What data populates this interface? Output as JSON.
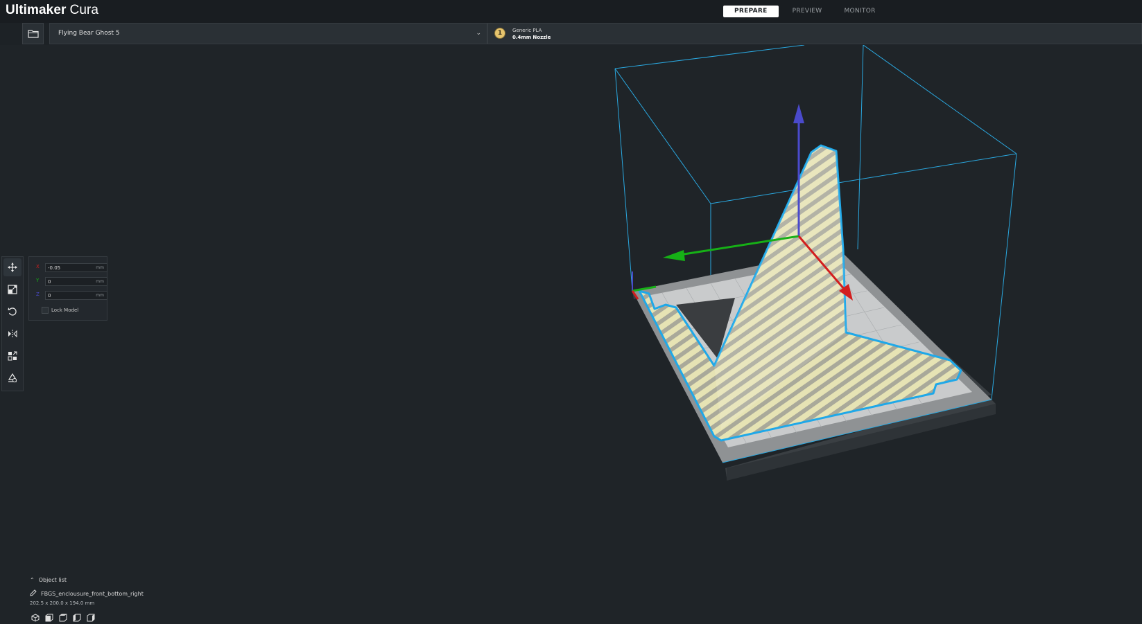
{
  "app": {
    "brand_bold": "Ultimaker",
    "brand_light": "Cura"
  },
  "stages": [
    {
      "label": "PREPARE",
      "active": true
    },
    {
      "label": "PREVIEW",
      "active": false
    },
    {
      "label": "MONITOR",
      "active": false
    }
  ],
  "printer": {
    "name": "Flying Bear Ghost 5"
  },
  "material": {
    "badge": "1",
    "name": "Generic PLA",
    "nozzle": "0.4mm Nozzle",
    "color": "#e6c46d"
  },
  "move_panel": {
    "x": {
      "axis": "X",
      "value": "-0.05",
      "unit": "mm"
    },
    "y": {
      "axis": "Y",
      "value": "0",
      "unit": "mm"
    },
    "z": {
      "axis": "Z",
      "value": "0",
      "unit": "mm"
    },
    "lock_label": "Lock Model"
  },
  "toolbar_icons": [
    "move-icon",
    "scale-icon",
    "rotate-icon",
    "mirror-icon",
    "per-model-settings-icon",
    "support-blocker-icon"
  ],
  "object_list": {
    "header": "Object list",
    "item": "FBGS_enclousure_front_bottom_right",
    "dimensions": "202.5 x 200.0 x 194.0 mm"
  },
  "view_icons": [
    "3d-view-icon",
    "front-view-icon",
    "top-view-icon",
    "left-view-icon",
    "right-view-icon"
  ],
  "colors": {
    "background": "#1f2428",
    "build_volume": "#2aa8e0",
    "model_outline": "#1fa8e8",
    "model_fill": "#e6e3b4",
    "axis_x": "#d21e1e",
    "axis_y": "#16b016",
    "axis_z": "#4a4acb"
  }
}
